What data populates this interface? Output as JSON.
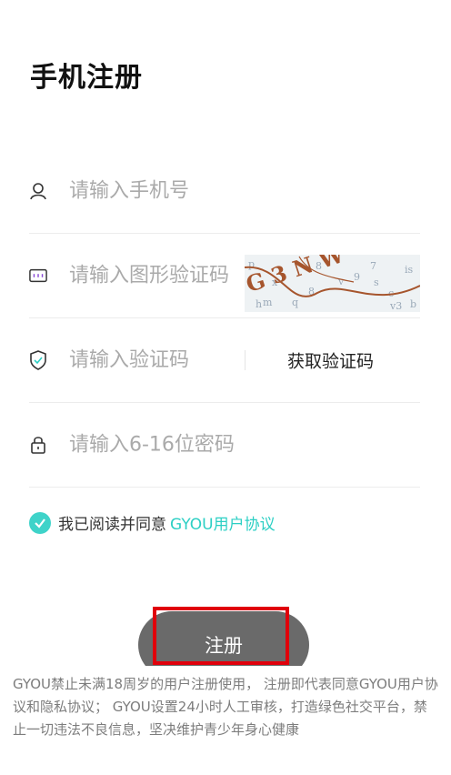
{
  "page": {
    "title": "手机注册"
  },
  "form": {
    "phone": {
      "placeholder": "请输入手机号",
      "icon": "user-icon"
    },
    "captcha": {
      "placeholder": "请输入图形验证码",
      "icon": "keyboard-icon",
      "image_text": "G 3 N W"
    },
    "sms_code": {
      "placeholder": "请输入验证码",
      "icon": "shield-icon",
      "get_code_label": "获取验证码"
    },
    "password": {
      "placeholder": "请输入6-16位密码",
      "icon": "lock-icon"
    }
  },
  "agreement": {
    "checked": true,
    "prefix": "我已阅读并同意",
    "link": "GYOU用户协议",
    "accent_color": "#2ccfc4"
  },
  "register_button": {
    "label": "注册"
  },
  "disclaimer": "GYOU禁止未满18周岁的用户注册使用， 注册即代表同意GYOU用户协议和隐私协议； GYOU设置24小时人工审核，打造绿色社交平台，禁止一切违法不良信息，坚决维护青少年身心健康"
}
